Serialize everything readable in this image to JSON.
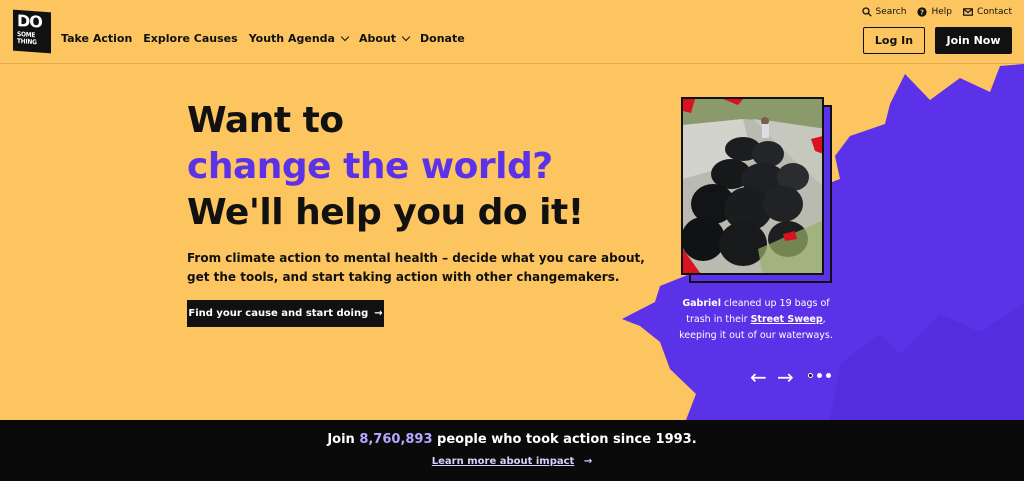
{
  "brand": {
    "logo_line1": "DO",
    "logo_line2": "SOME\nTHING"
  },
  "nav": {
    "items": [
      {
        "label": "Take Action",
        "dropdown": false
      },
      {
        "label": "Explore Causes",
        "dropdown": false
      },
      {
        "label": "Youth Agenda",
        "dropdown": true
      },
      {
        "label": "About",
        "dropdown": true
      },
      {
        "label": "Donate",
        "dropdown": false
      }
    ]
  },
  "utility": {
    "search": "Search",
    "help": "Help",
    "contact": "Contact"
  },
  "auth": {
    "login": "Log In",
    "join": "Join Now"
  },
  "hero": {
    "line1": "Want to",
    "line2": "change the world?",
    "line3": "We'll help you do it!",
    "subtext": "From climate action to mental health – decide what you care about, get the tools, and start taking action with other changemakers.",
    "cta": "Find your cause and start doing",
    "cta_arrow": "→"
  },
  "story": {
    "name": "Gabriel",
    "text_before": " cleaned up 19 bags of trash in their ",
    "link": "Street Sweep",
    "text_after": ", keeping it out of our waterways."
  },
  "carousel": {
    "prev": "←",
    "next": "→",
    "slides": 3,
    "active": 0
  },
  "impact": {
    "prefix": "Join ",
    "count": "8,760,893",
    "suffix": " people who took action since 1993.",
    "link": "Learn more about impact",
    "link_arrow": "→"
  },
  "colors": {
    "background": "#fcc55f",
    "accent": "#5b32e8",
    "dark": "#0a0a0a"
  }
}
